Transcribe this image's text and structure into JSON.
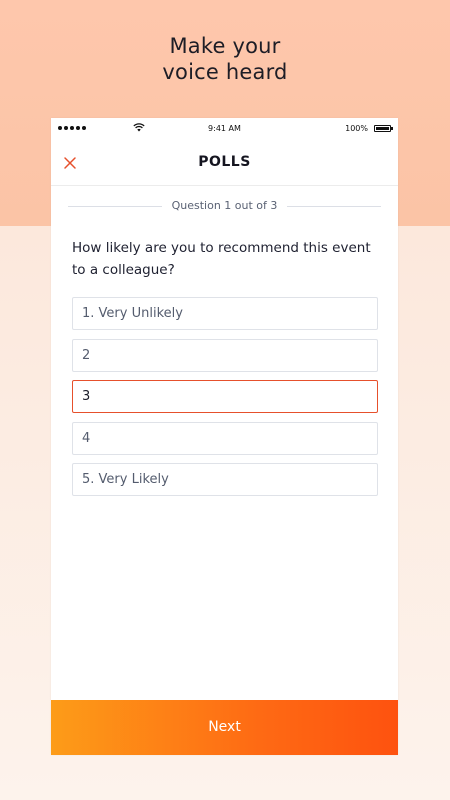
{
  "headline": {
    "line1": "Make your",
    "line2": "voice heard"
  },
  "status_bar": {
    "time": "9:41 AM",
    "battery": "100%"
  },
  "nav": {
    "title": "POLLS",
    "close_icon": "close-icon"
  },
  "poll": {
    "counter": "Question 1 out of 3",
    "question": "How likely are you to recommend this event to a colleague?",
    "options": [
      {
        "label": "1. Very Unlikely",
        "selected": false
      },
      {
        "label": "2",
        "selected": false
      },
      {
        "label": "3",
        "selected": true
      },
      {
        "label": "4",
        "selected": false
      },
      {
        "label": "5. Very Likely",
        "selected": false
      }
    ]
  },
  "footer": {
    "next_label": "Next"
  },
  "colors": {
    "accent": "#e6502c",
    "button_start": "#fd9c18",
    "button_end": "#fe520f"
  }
}
